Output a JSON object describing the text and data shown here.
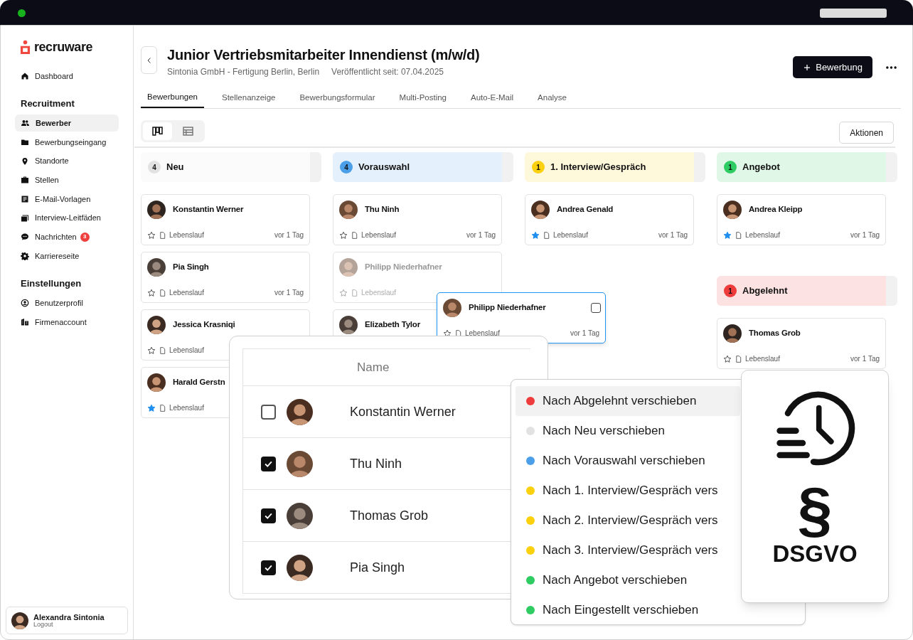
{
  "sidebar": {
    "logo": "recruware",
    "sections": [
      {
        "items": [
          {
            "label": "Dashboard",
            "selected": false
          }
        ]
      },
      {
        "title": "Recruitment",
        "items": [
          {
            "label": "Bewerber",
            "selected": true
          },
          {
            "label": "Bewerbungseingang",
            "selected": false
          },
          {
            "label": "Standorte",
            "selected": false
          },
          {
            "label": "Stellen",
            "selected": false
          },
          {
            "label": "E-Mail-Vorlagen",
            "selected": false
          },
          {
            "label": "Interview-Leitfäden",
            "selected": false
          },
          {
            "label": "Nachrichten",
            "selected": false,
            "badge": "3"
          },
          {
            "label": "Karriereseite",
            "selected": false
          }
        ]
      },
      {
        "title": "Einstellungen",
        "items": [
          {
            "label": "Benutzerprofil",
            "selected": false
          },
          {
            "label": "Firmenaccount",
            "selected": false
          }
        ]
      }
    ],
    "user": {
      "name": "Alexandra Sintonia",
      "action": "Logout"
    }
  },
  "header": {
    "title": "Junior Vertriebsmitarbeiter Innendienst (m/w/d)",
    "company": "Sintonia GmbH - Fertigung Berlin, Berlin",
    "published": "Veröffentlicht seit: 07.04.2025",
    "primary_button": "Bewerbung"
  },
  "tabs": [
    {
      "label": "Bewerbungen",
      "selected": true
    },
    {
      "label": "Stellenanzeige",
      "selected": false
    },
    {
      "label": "Bewerbungsformular",
      "selected": false
    },
    {
      "label": "Multi-Posting",
      "selected": false
    },
    {
      "label": "Auto-E-Mail",
      "selected": false
    },
    {
      "label": "Analyse",
      "selected": false
    }
  ],
  "view_toggle": [
    {
      "kind": "board",
      "selected": true
    },
    {
      "kind": "list",
      "selected": false
    }
  ],
  "actions_button": "Aktionen",
  "lanes": [
    {
      "stages": [
        {
          "title": "Neu",
          "count": "4",
          "color": "#e2e2e2",
          "cards": [
            {
              "name": "Konstantin Werner",
              "starred": false,
              "file": "Lebenslauf",
              "time": "vor 1 Tag",
              "faded": false
            },
            {
              "name": "Pia Singh",
              "starred": false,
              "file": "Lebenslauf",
              "time": "vor 1 Tag",
              "faded": false
            },
            {
              "name": "Jessica Krasniqi",
              "starred": false,
              "file": "Lebenslauf",
              "faded": false
            },
            {
              "name": "Harald Gerstn",
              "starred": true,
              "file": "Lebenslauf",
              "faded": false
            }
          ]
        }
      ]
    },
    {
      "stages": [
        {
          "title": "Vorauswahl",
          "count": "4",
          "color": "#4a9fe8",
          "cards": [
            {
              "name": "Thu Ninh",
              "starred": false,
              "file": "Lebenslauf",
              "time": "vor 1 Tag",
              "faded": false
            },
            {
              "name": "Philipp Niederhafner",
              "starred": false,
              "file": "Lebenslauf",
              "faded": true
            },
            {
              "name": "Elizabeth Tylor",
              "faded": false
            }
          ]
        }
      ]
    },
    {
      "stages": [
        {
          "title": "1. Interview/Gespräch",
          "count": "1",
          "color": "#fbd00e",
          "cards": [
            {
              "name": "Andrea Genald",
              "starred": true,
              "file": "Lebenslauf",
              "time": "vor 1 Tag",
              "faded": false
            }
          ]
        }
      ]
    },
    {
      "stages": [
        {
          "title": "Angebot",
          "count": "1",
          "color": "#2ecc62",
          "cards": [
            {
              "name": "Andrea Kleipp",
              "starred": true,
              "file": "Lebenslauf",
              "time": "vor 1 Tag",
              "faded": false
            }
          ]
        },
        {
          "title": "Abgelehnt",
          "count": "1",
          "color": "#ee3b3b",
          "cards": [
            {
              "name": "Thomas Grob",
              "starred": false,
              "file": "Lebenslauf",
              "time": "vor 1 Tag",
              "faded": false
            }
          ]
        }
      ]
    }
  ],
  "dragged_card": {
    "name": "Philipp Niederhafner",
    "starred": false,
    "file": "Lebenslauf",
    "time": "vor 1 Tag",
    "checked": false
  },
  "table": {
    "columns": [
      "Name"
    ],
    "rows": [
      {
        "name": "Konstantin Werner",
        "checked": false
      },
      {
        "name": "Thu Ninh",
        "checked": true
      },
      {
        "name": "Thomas Grob",
        "checked": true
      },
      {
        "name": "Pia Singh",
        "checked": true
      }
    ]
  },
  "move_menu": [
    {
      "label": "Nach Abgelehnt verschieben",
      "color": "#ee3b3b",
      "selected": true
    },
    {
      "label": "Nach Neu verschieben",
      "color": "#e2e2e2",
      "selected": false
    },
    {
      "label": "Nach Vorauswahl verschieben",
      "color": "#4a9fe8",
      "selected": false
    },
    {
      "label": "Nach 1. Interview/Gespräch vers",
      "color": "#fbd00e",
      "selected": false
    },
    {
      "label": "Nach 2. Interview/Gespräch vers",
      "color": "#fbd00e",
      "selected": false
    },
    {
      "label": "Nach 3. Interview/Gespräch vers",
      "color": "#fbd00e",
      "selected": false
    },
    {
      "label": "Nach Angebot verschieben",
      "color": "#2ecc62",
      "selected": false
    },
    {
      "label": "Nach Eingestellt verschieben",
      "color": "#2ecc62",
      "selected": false
    }
  ],
  "dsgvo": {
    "symbol": "§",
    "label": "DSGVO"
  }
}
